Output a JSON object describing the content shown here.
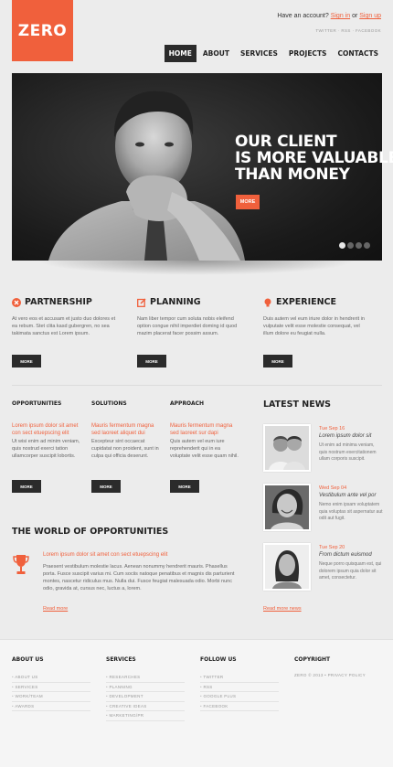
{
  "header": {
    "logo": "ZERO",
    "account_prompt": "Have an account?",
    "sign_in": "Sign in",
    "or": "or",
    "sign_up": "Sign up",
    "social": "TWITTER · RSS · FACEBOOK",
    "nav": [
      "HOME",
      "ABOUT",
      "SERVICES",
      "PROJECTS",
      "CONTACTS"
    ],
    "nav_active": "HOME"
  },
  "hero": {
    "title_lines": [
      "OUR CLIENT",
      "IS MORE VALUABLE",
      "THAN MONEY"
    ],
    "more": "MORE",
    "slides": 4,
    "active_slide": 1
  },
  "features": [
    {
      "title": "PARTNERSHIP",
      "icon": "x-circle-icon",
      "text": "At vero eos et accusam et justo duo dolores et ea rebum. Stet clita kasd gubergren, no sea takimata sanctus est Lorem ipsum.",
      "button": "MORE"
    },
    {
      "title": "PLANNING",
      "icon": "edit-icon",
      "text": "Nam liber tempor cum soluta nobis eleifend option congue nihil imperdiet doming id quod mazim placerat facer possim assum.",
      "button": "MORE"
    },
    {
      "title": "EXPERIENCE",
      "icon": "lightbulb-icon",
      "text": "Duis autem vel eum iriure dolor in hendrerit in vulputate velit esse molestie consequat, vel illum dolore eu feugiat nulla.",
      "button": "MORE"
    }
  ],
  "columns": [
    {
      "title": "OPPORTUNITIES",
      "lead": "Lorem ipsum dolor sit amet con sect etuepscing elit",
      "text": "Ut wisi enim ad minim veniam, quis nostrud exerci tation ullamcorper suscipit lobortis.",
      "button": "MORE"
    },
    {
      "title": "SOLUTIONS",
      "lead": "Mauris fermentum magna sed laoreet aliquet dui",
      "text": "Excepteur sint occaecat cupidatat non proident, sunt in culpa qui officia deserunt.",
      "button": "MORE"
    },
    {
      "title": "APPROACH",
      "lead": "Mauris fermentum magna sed laoreet sur dapi",
      "text": "Quis autem vel eum iure reprehenderit qui in ea voluptate velit esse quam nihil.",
      "button": "MORE"
    }
  ],
  "world": {
    "title": "THE WORLD OF OPPORTUNITIES",
    "lead": "Lorem ipsum dolor sit amet con sect etuepscing elit",
    "text": "Praesent vestibulum molestie lacus. Aenean nonummy hendrerit mauris. Phasellus porta. Fusce suscipit varius mi. Cum sociis natoque penatibus et magnis dis parturient montes, nascetur ridiculus mus. Nulla dui. Fusce feugiat malesuada odio. Morbi nunc odio, gravida at, cursus nec, luctus a, lorem.",
    "read_more": "Read more"
  },
  "news": {
    "title": "LATEST NEWS",
    "items": [
      {
        "date": "Tue Sep 16",
        "head": "Lorem ipsum dolor sit",
        "text": "Ut enim ad minima veniam, quis nostrum exercitationem ullam corporis suscipit."
      },
      {
        "date": "Wed Sep 04",
        "head": "Vestibulum ante vel por",
        "text": "Nemo enim ipsam voluptatem quia voluptas sit aspernatur aut odit aut fugit."
      },
      {
        "date": "Tue Sep 20",
        "head": "From dictum euismod",
        "text": "Neque porro quisquam est, qui dolorem ipsum quia dolor sit amet, consectetur."
      }
    ],
    "read_more": "Read more news"
  },
  "footer": {
    "columns": [
      {
        "title": "ABOUT US",
        "items": [
          "ABOUT US",
          "SERVICES",
          "WORK/TEAM",
          "AWARDS"
        ]
      },
      {
        "title": "SERVICES",
        "items": [
          "RESEARCHES",
          "PLANNING",
          "DEVELOPMENT",
          "CREATIVE IDEAS",
          "MARKETING/PR"
        ]
      },
      {
        "title": "FOLLOW US",
        "items": [
          "TWITTER",
          "RSS",
          "GOOGLE PLUS",
          "FACEBOOK"
        ]
      }
    ],
    "copyright_title": "COPYRIGHT",
    "copyright_text": "ZERO © 2013 • PRIVACY POLICY"
  },
  "colors": {
    "accent": "#f0603c",
    "dark": "#2b2b2b",
    "background": "#ececec"
  }
}
